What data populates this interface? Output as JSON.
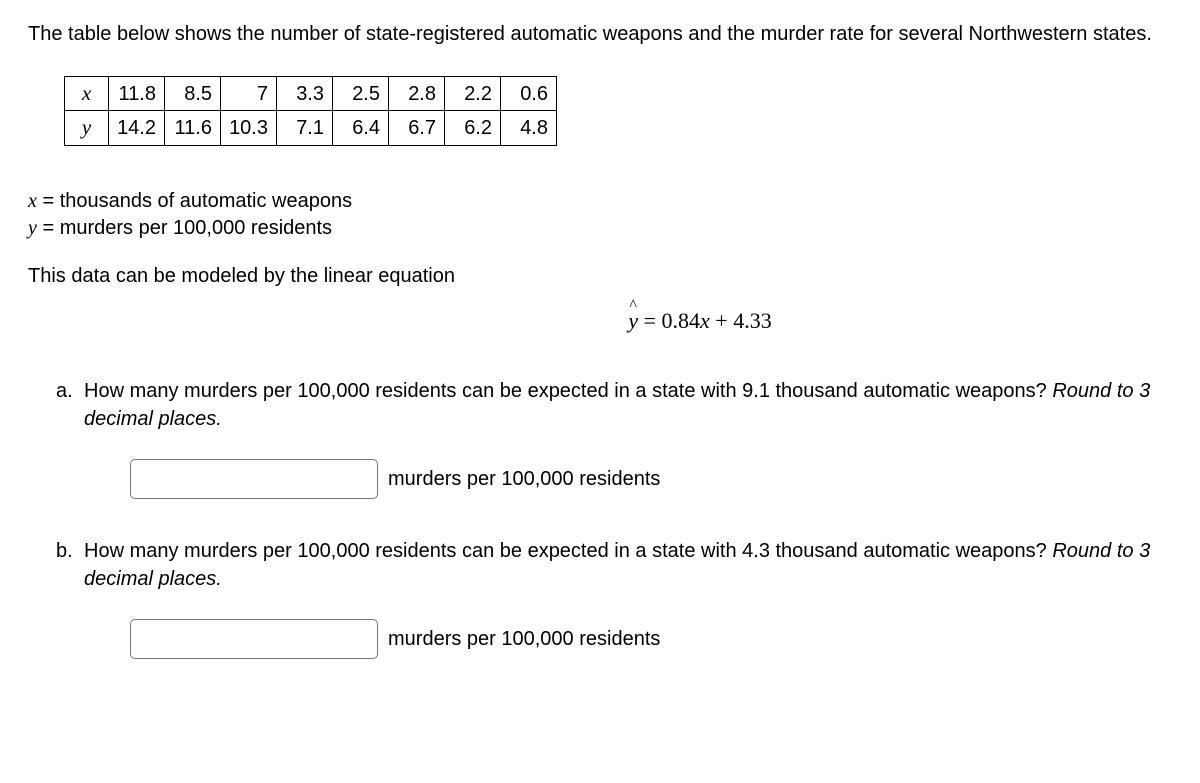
{
  "intro": "The table below shows the number of state-registered automatic weapons and the murder rate for several Northwestern states.",
  "table": {
    "row_x_label": "x",
    "row_y_label": "y",
    "x": [
      "11.8",
      "8.5",
      "7",
      "3.3",
      "2.5",
      "2.8",
      "2.2",
      "0.6"
    ],
    "y": [
      "14.2",
      "11.6",
      "10.3",
      "7.1",
      "6.4",
      "6.7",
      "6.2",
      "4.8"
    ]
  },
  "defs": {
    "x_var": "x",
    "x_eq": " = ",
    "x_desc": "thousands of automatic weapons",
    "y_var": "y",
    "y_eq": " = ",
    "y_desc": "murders per 100,000 residents"
  },
  "model_prompt": "This data can be modeled by the linear equation",
  "equation": {
    "lhs": "y",
    "eq": "  =  ",
    "slope": "0.84",
    "xvar": "x",
    "plus": " + ",
    "intercept": "4.33"
  },
  "questions": {
    "a": {
      "letter": "a.",
      "text_1": "How many murders per 100,000 residents can be expected in a state with 9.1 thousand automatic weapons? ",
      "text_2": "Round to 3 decimal places.",
      "unit": "murders per 100,000 residents"
    },
    "b": {
      "letter": "b.",
      "text_1": "How many murders per 100,000 residents can be expected in a state with 4.3 thousand automatic weapons? ",
      "text_2": "Round to 3 decimal places.",
      "unit": "murders per 100,000 residents"
    }
  }
}
